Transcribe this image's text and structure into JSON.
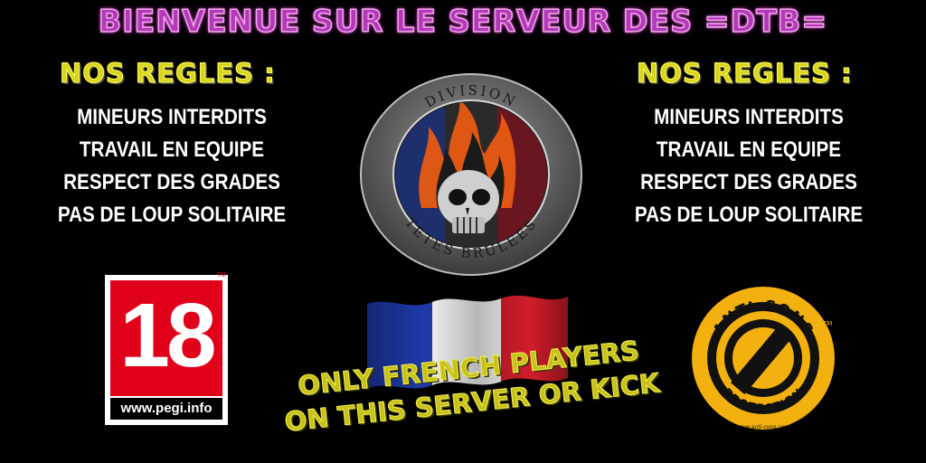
{
  "title": "BIENVENUE SUR LE SERVEUR DES =DTB=",
  "left_rules": {
    "heading": "NOS REGLES :",
    "items": [
      "MINEURS INTERDITS",
      "TRAVAIL EN EQUIPE",
      "RESPECT DES GRADES",
      "PAS DE LOUP SOLITAIRE"
    ]
  },
  "right_rules": {
    "heading": "NOS REGLES :",
    "items": [
      "MINEURS INTERDITS",
      "TRAVAIL EN EQUIPE",
      "RESPECT DES GRADES",
      "PAS DE LOUP SOLITAIRE"
    ]
  },
  "emblem": {
    "top_text": "DIVISION",
    "bottom_text": "TETES BRULEES",
    "icon": "flaming-skull-icon"
  },
  "pegi": {
    "rating": "18",
    "url": "www.pegi.info",
    "tm": "TM",
    "color": "#e1001a"
  },
  "flag": {
    "icon": "french-flag-icon",
    "colors": [
      "#1e3aa8",
      "#ffffff",
      "#d01d2a"
    ]
  },
  "notice": {
    "line1": "ONLY FRENCH PLAYERS",
    "line2": "ON THIS SERVER OR KICK"
  },
  "anticons": {
    "top_text": "ANTI-CONS",
    "bottom_text": "PROTECTION",
    "url": "www.anti-cons.com",
    "tm": "TM",
    "color": "#f2b10f",
    "icon": "prohibition-sign-icon"
  },
  "colors": {
    "background": "#000000",
    "title": "#b23ab8",
    "heading": "#d9d61a",
    "notice": "#c7c21a"
  }
}
